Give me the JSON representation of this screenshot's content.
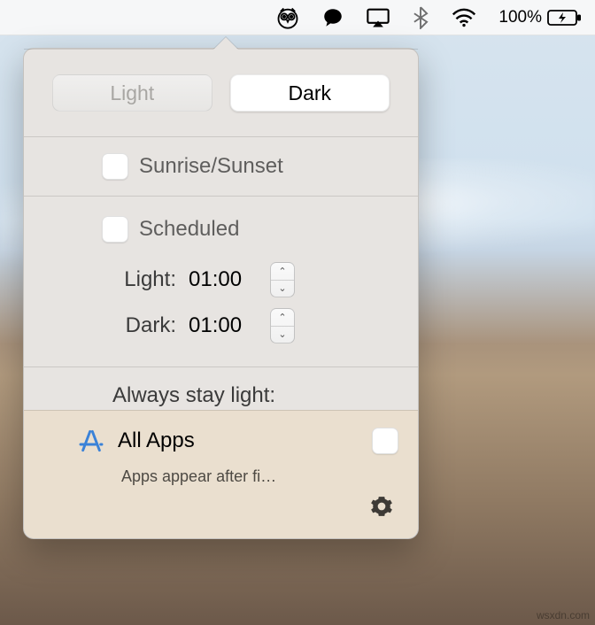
{
  "menubar": {
    "battery_pct": "100%"
  },
  "toggle": {
    "light_label": "Light",
    "dark_label": "Dark"
  },
  "sunrise": {
    "label": "Sunrise/Sunset"
  },
  "scheduled": {
    "label": "Scheduled",
    "light_label": "Light:",
    "light_value": "01:00",
    "dark_label": "Dark:",
    "dark_value": "01:00"
  },
  "always": {
    "title": "Always stay light:"
  },
  "apps": {
    "all_label": "All Apps",
    "hint": "Apps appear after fi…"
  },
  "watermark": "wsxdn.com"
}
